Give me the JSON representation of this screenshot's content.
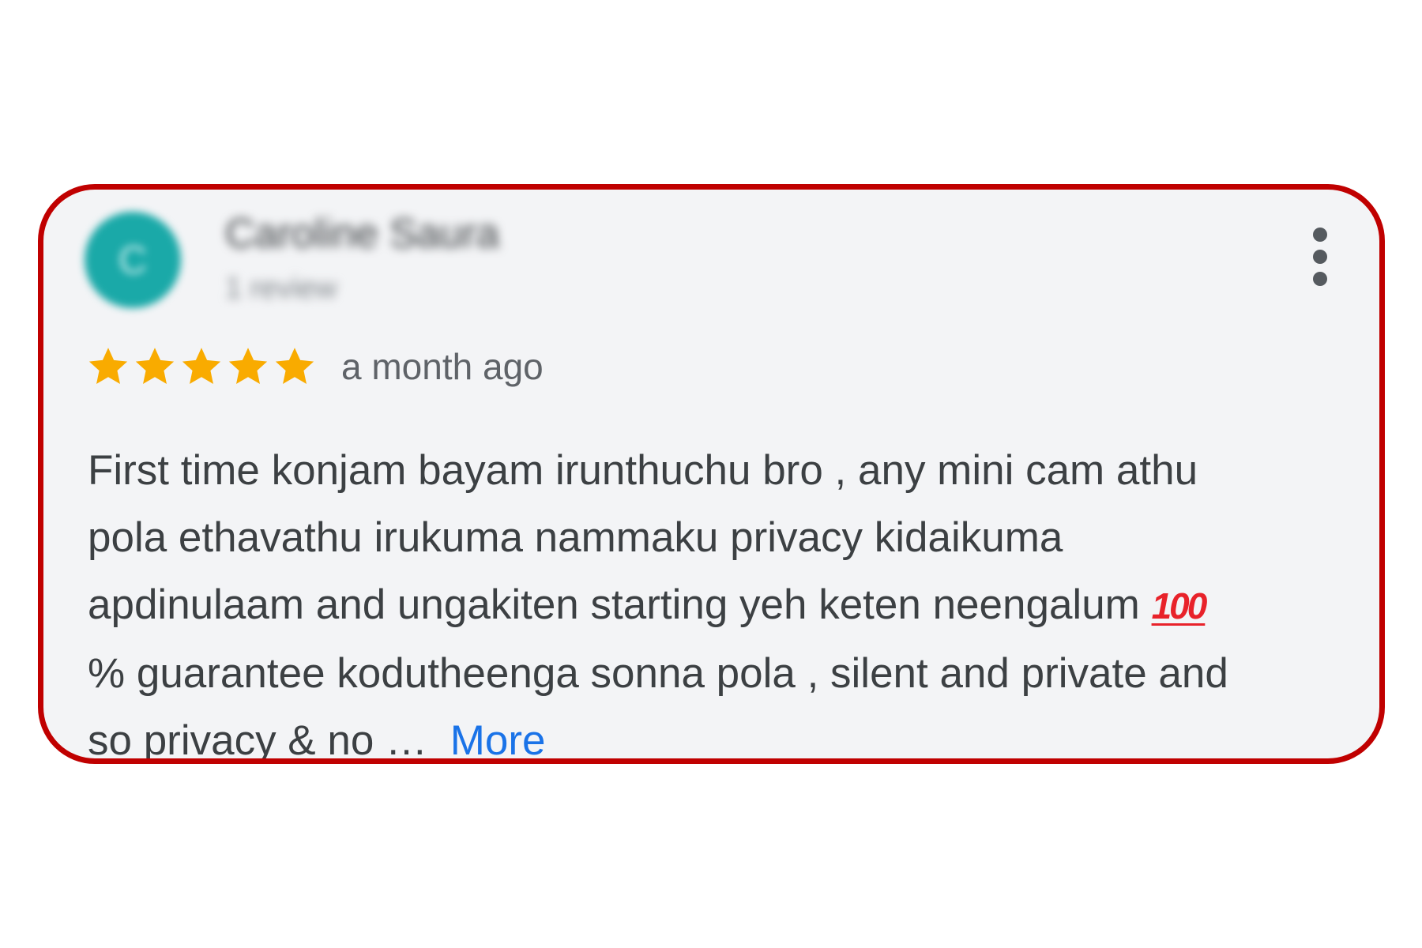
{
  "review": {
    "avatar_initial": "C",
    "reviewer_name": "Caroline Saura",
    "reviewer_meta": "1 review",
    "more_options_icon": "more-vert-icon",
    "rating_stars": 5,
    "rating_max": 5,
    "star_color": "#f9ab00",
    "timestamp": "a month ago",
    "text_lines": [
      "First time konjam bayam irunthuchu bro , any mini cam athu",
      "pola ethavathu irukuma nammaku privacy kidaikuma",
      "apdinulaam and ungakiten starting yeh keten neengalum ",
      "% guarantee kodutheenga sonna pola , silent and private and",
      "so privacy & no … "
    ],
    "emoji_100": "100",
    "more_label": "More"
  },
  "colors": {
    "card_border": "#c00000",
    "card_background": "#f3f4f6",
    "avatar_background": "#1aa9a8",
    "link": "#1a73e8"
  }
}
